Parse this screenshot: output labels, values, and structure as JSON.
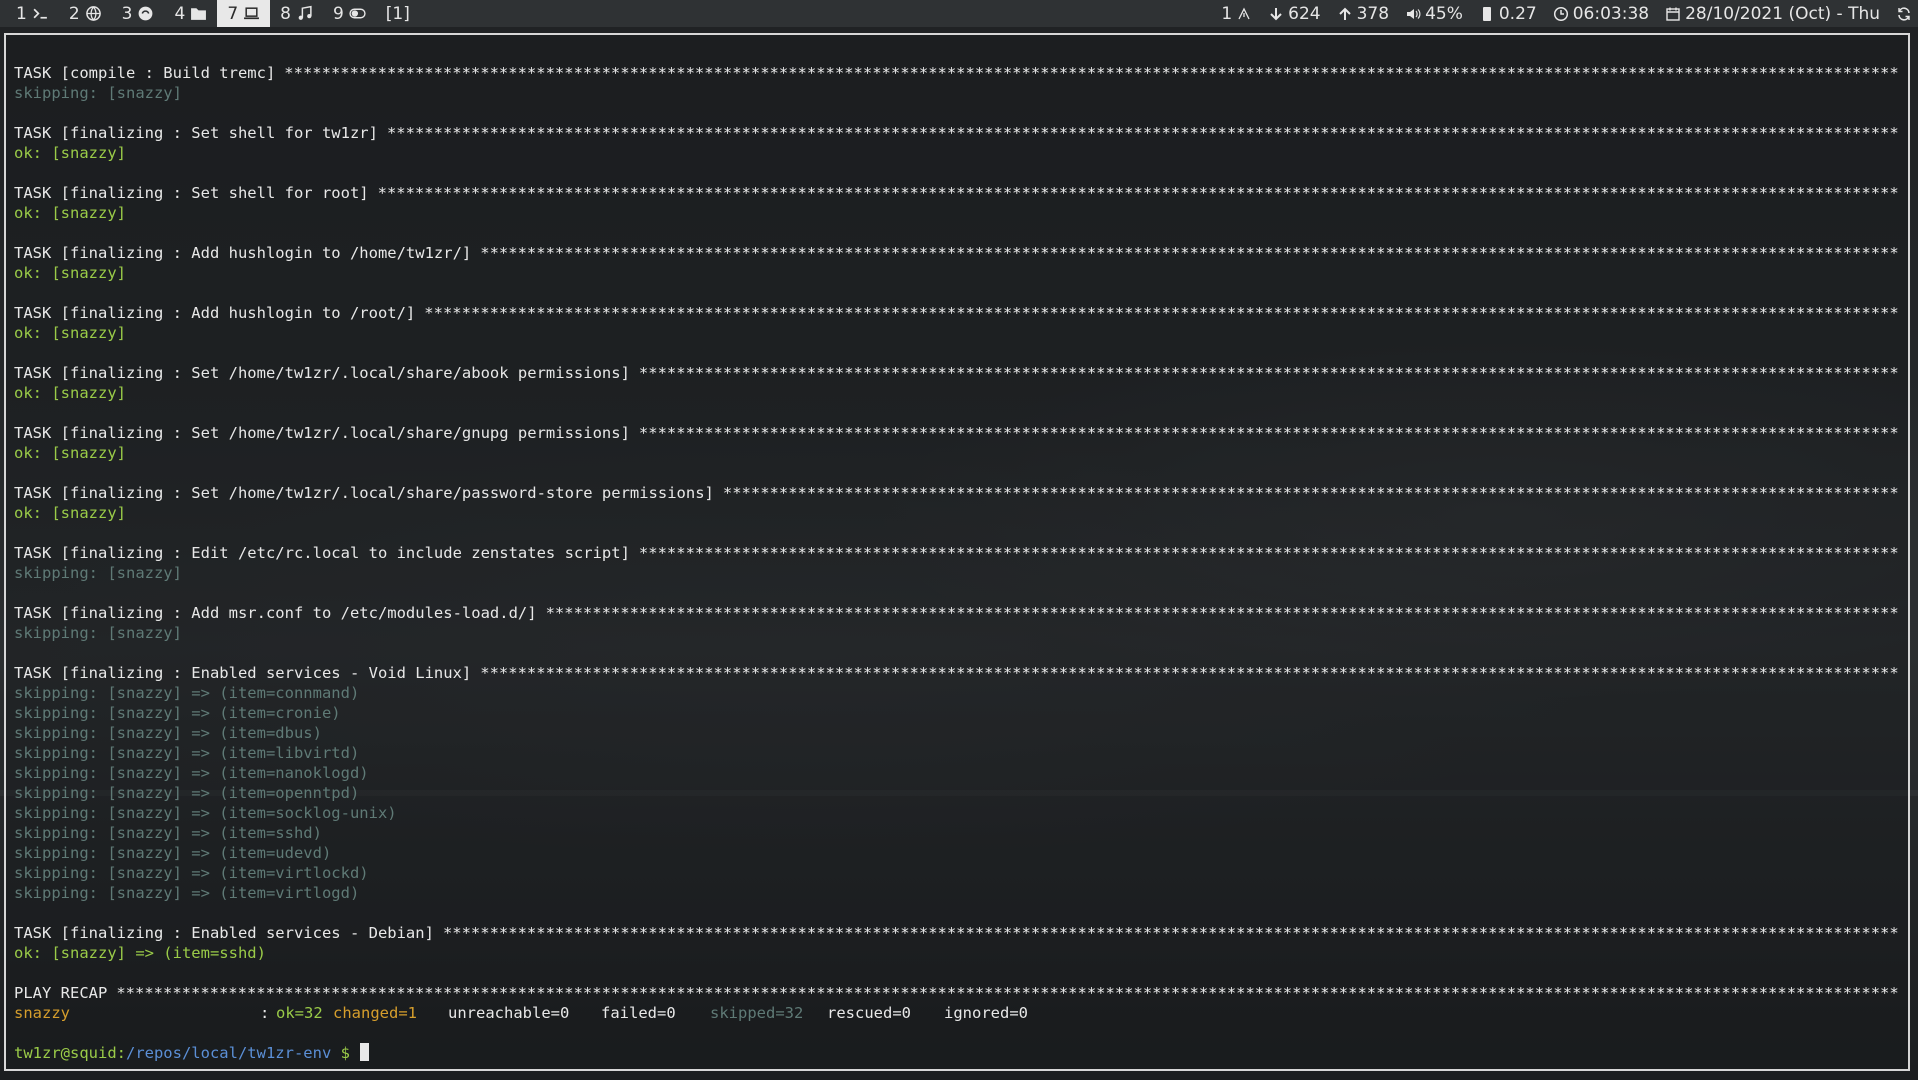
{
  "topbar": {
    "workspaces": [
      {
        "num": "1",
        "icon": "terminal-icon",
        "active": false
      },
      {
        "num": "2",
        "icon": "globe-icon",
        "active": false
      },
      {
        "num": "3",
        "icon": "chat-icon",
        "active": false
      },
      {
        "num": "4",
        "icon": "folder-icon",
        "active": false
      },
      {
        "num": "7",
        "icon": "laptop-icon",
        "active": true
      },
      {
        "num": "8",
        "icon": "music-icon",
        "active": false
      },
      {
        "num": "9",
        "icon": "toggle-icon",
        "active": false
      }
    ],
    "window_count": "[1]",
    "status": {
      "updates": "1",
      "download": "624",
      "upload": "378",
      "volume": "45%",
      "load": "0.27",
      "time": "06:03:38",
      "date": "28/10/2021 (Oct) - Thu"
    }
  },
  "terminal": {
    "stars": "**********************************************************************************************************************************************************************************************************************************",
    "tasks": [
      {
        "name": "TASK [compile : Build tremc]",
        "results": [
          {
            "type": "skip",
            "text": "skipping: [snazzy]"
          }
        ]
      },
      {
        "name": "TASK [finalizing : Set shell for tw1zr]",
        "results": [
          {
            "type": "ok",
            "text": "ok: [snazzy]"
          }
        ]
      },
      {
        "name": "TASK [finalizing : Set shell for root]",
        "results": [
          {
            "type": "ok",
            "text": "ok: [snazzy]"
          }
        ]
      },
      {
        "name": "TASK [finalizing : Add hushlogin to /home/tw1zr/]",
        "results": [
          {
            "type": "ok",
            "text": "ok: [snazzy]"
          }
        ]
      },
      {
        "name": "TASK [finalizing : Add hushlogin to /root/]",
        "results": [
          {
            "type": "ok",
            "text": "ok: [snazzy]"
          }
        ]
      },
      {
        "name": "TASK [finalizing : Set /home/tw1zr/.local/share/abook permissions]",
        "results": [
          {
            "type": "ok",
            "text": "ok: [snazzy]"
          }
        ]
      },
      {
        "name": "TASK [finalizing : Set /home/tw1zr/.local/share/gnupg permissions]",
        "results": [
          {
            "type": "ok",
            "text": "ok: [snazzy]"
          }
        ]
      },
      {
        "name": "TASK [finalizing : Set /home/tw1zr/.local/share/password-store permissions]",
        "results": [
          {
            "type": "ok",
            "text": "ok: [snazzy]"
          }
        ]
      },
      {
        "name": "TASK [finalizing : Edit /etc/rc.local to include zenstates script]",
        "results": [
          {
            "type": "skip",
            "text": "skipping: [snazzy]"
          }
        ]
      },
      {
        "name": "TASK [finalizing : Add msr.conf to /etc/modules-load.d/]",
        "results": [
          {
            "type": "skip",
            "text": "skipping: [snazzy]"
          }
        ]
      },
      {
        "name": "TASK [finalizing : Enabled services - Void Linux]",
        "results": [
          {
            "type": "skip",
            "text": "skipping: [snazzy] => (item=connmand)"
          },
          {
            "type": "skip",
            "text": "skipping: [snazzy] => (item=cronie)"
          },
          {
            "type": "skip",
            "text": "skipping: [snazzy] => (item=dbus)"
          },
          {
            "type": "skip",
            "text": "skipping: [snazzy] => (item=libvirtd)"
          },
          {
            "type": "skip",
            "text": "skipping: [snazzy] => (item=nanoklogd)"
          },
          {
            "type": "skip",
            "text": "skipping: [snazzy] => (item=openntpd)"
          },
          {
            "type": "skip",
            "text": "skipping: [snazzy] => (item=socklog-unix)"
          },
          {
            "type": "skip",
            "text": "skipping: [snazzy] => (item=sshd)"
          },
          {
            "type": "skip",
            "text": "skipping: [snazzy] => (item=udevd)"
          },
          {
            "type": "skip",
            "text": "skipping: [snazzy] => (item=virtlockd)"
          },
          {
            "type": "skip",
            "text": "skipping: [snazzy] => (item=virtlogd)"
          }
        ]
      },
      {
        "name": "TASK [finalizing : Enabled services - Debian]",
        "results": [
          {
            "type": "ok",
            "text": "ok: [snazzy] => (item=sshd)"
          }
        ]
      }
    ],
    "recap": {
      "header": "PLAY RECAP",
      "host": "snazzy",
      "colon": ":",
      "ok": "ok=32",
      "changed": "changed=1",
      "unreachable": "unreachable=0",
      "failed": "failed=0",
      "skipped": "skipped=32",
      "rescued": "rescued=0",
      "ignored": "ignored=0"
    },
    "prompt": {
      "user_host": "tw1zr@squid:",
      "path": "/repos/local/tw1zr-env",
      "symbol": "$"
    }
  }
}
